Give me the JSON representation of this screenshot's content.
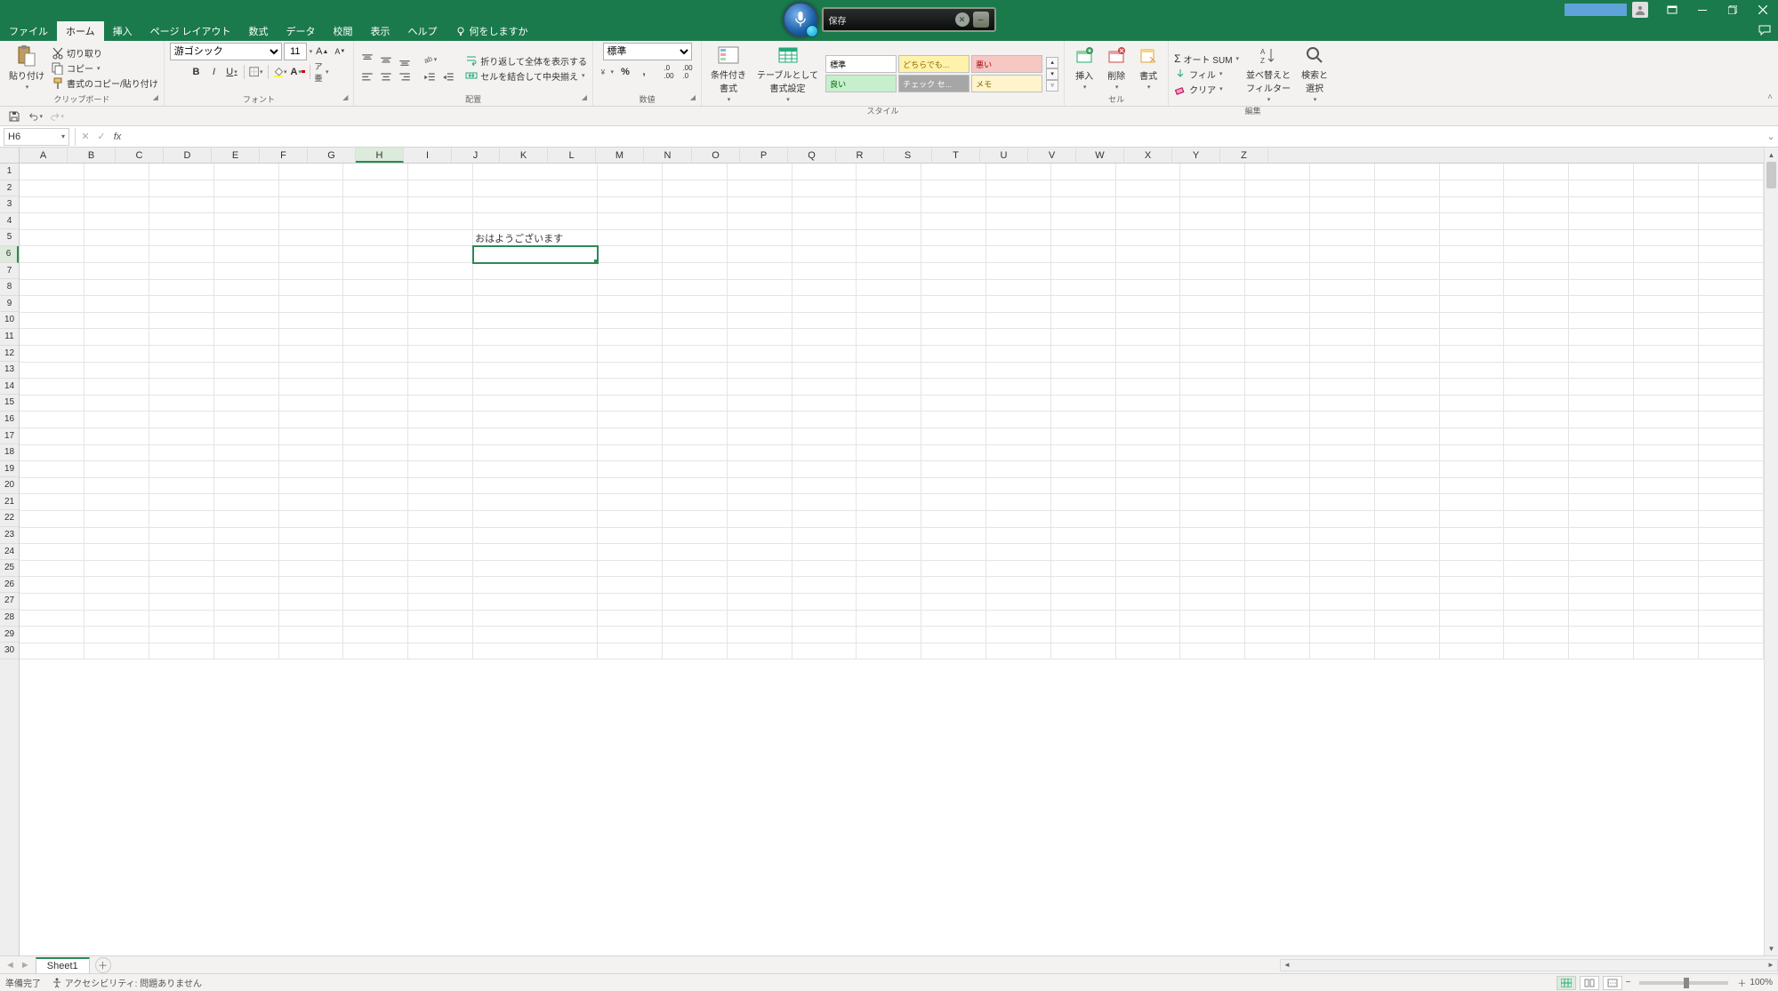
{
  "titlebar": {
    "tabs": [
      "ファイル",
      "ホーム",
      "挿入",
      "ページ レイアウト",
      "数式",
      "データ",
      "校閲",
      "表示",
      "ヘルプ"
    ],
    "active_tab_index": 1,
    "tellme": "何をしますか",
    "voice": {
      "text": "保存"
    },
    "window_controls": {
      "min": "–",
      "restore": "❐",
      "close": "✕",
      "ribbon_opts": "▾"
    }
  },
  "ribbon": {
    "clipboard": {
      "label": "クリップボード",
      "paste": "貼り付け",
      "cut": "切り取り",
      "copy": "コピー",
      "format_painter": "書式のコピー/貼り付け"
    },
    "font": {
      "label": "フォント",
      "name": "游ゴシック",
      "size": "11",
      "bold": "B",
      "italic": "I",
      "underline": "U"
    },
    "alignment": {
      "label": "配置",
      "wrap": "折り返して全体を表示する",
      "merge": "セルを結合して中央揃え"
    },
    "number": {
      "label": "数値",
      "format": "標準"
    },
    "styles": {
      "label": "スタイル",
      "conditional": "条件付き\n書式",
      "table": "テーブルとして\n書式設定",
      "gallery": [
        {
          "text": "標準",
          "bg": "#ffffff",
          "fg": "#000"
        },
        {
          "text": "どちらでも...",
          "bg": "#fff2ab",
          "fg": "#8a6d00"
        },
        {
          "text": "悪い",
          "bg": "#f7c7c4",
          "fg": "#9c0006"
        },
        {
          "text": "良い",
          "bg": "#c6efce",
          "fg": "#006100"
        },
        {
          "text": "チェック セ...",
          "bg": "#a6a6a6",
          "fg": "#ffffff"
        },
        {
          "text": "メモ",
          "bg": "#fff4cc",
          "fg": "#7f6000"
        }
      ]
    },
    "cells": {
      "label": "セル",
      "insert": "挿入",
      "delete": "削除",
      "format": "書式"
    },
    "editing": {
      "label": "編集",
      "autosum": "オート SUM",
      "fill": "フィル",
      "clear": "クリア",
      "sort": "並べ替えと\nフィルター",
      "find": "検索と\n選択"
    }
  },
  "formula_bar": {
    "name_box": "H6",
    "formula": ""
  },
  "grid": {
    "columns": [
      "A",
      "B",
      "C",
      "D",
      "E",
      "F",
      "G",
      "H",
      "I",
      "J",
      "K",
      "L",
      "M",
      "N",
      "O",
      "P",
      "Q",
      "R",
      "S",
      "T",
      "U",
      "V",
      "W",
      "X",
      "Y",
      "Z"
    ],
    "row_count": 30,
    "selected": {
      "col": "H",
      "row": 6
    },
    "cells": {
      "H5": "おはようございます"
    }
  },
  "sheet_bar": {
    "active": "Sheet1"
  },
  "status": {
    "ready": "準備完了",
    "accessibility": "アクセシビリティ: 問題ありません",
    "zoom": "100%"
  }
}
